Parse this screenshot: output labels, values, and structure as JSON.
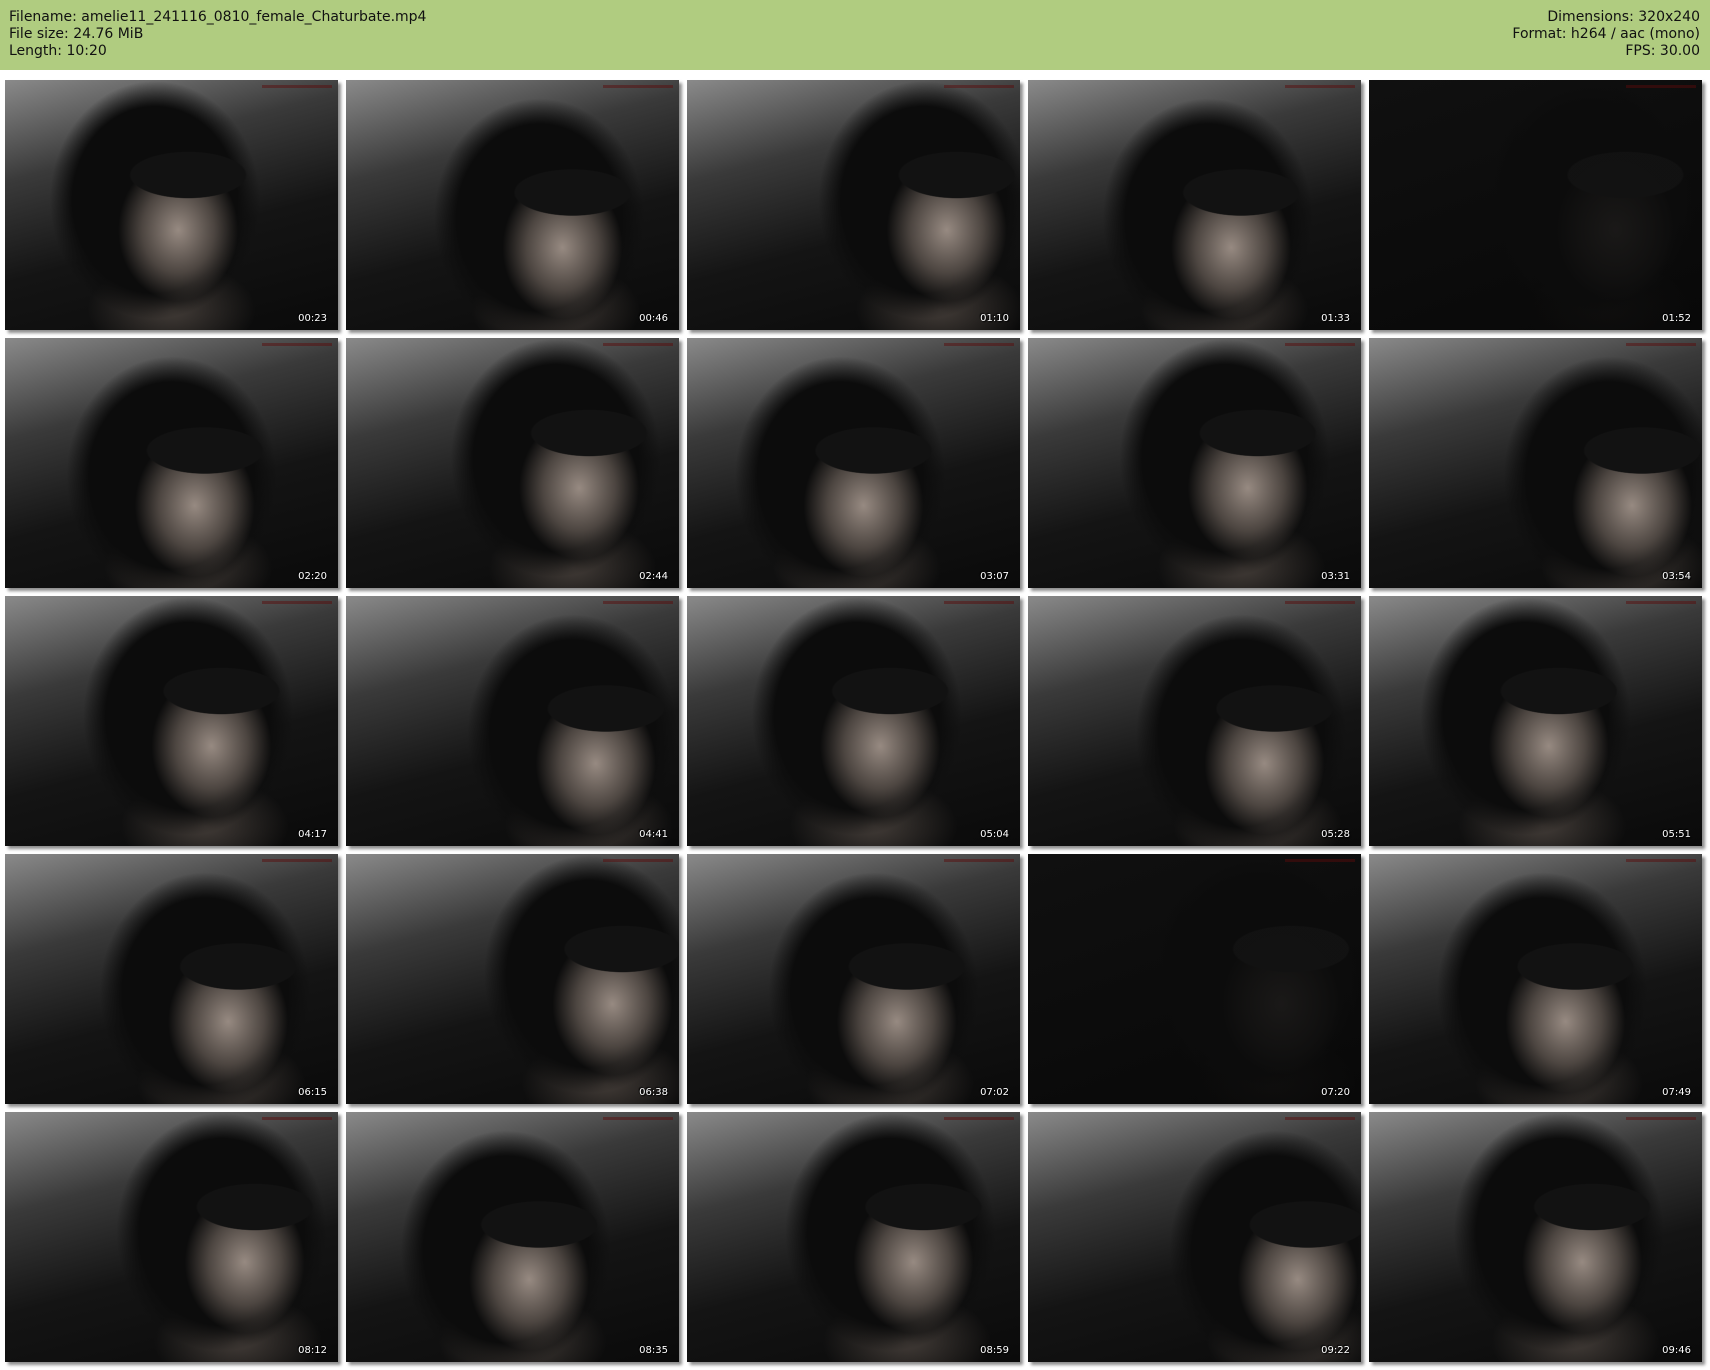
{
  "header": {
    "filename": "Filename: amelie11_241116_0810_female_Chaturbate.mp4",
    "file_size": "File size: 24.76 MiB",
    "length": "Length: 10:20",
    "dimensions": "Dimensions: 320x240",
    "format": "Format: h264 / aac (mono)",
    "fps": "FPS: 30.00"
  },
  "thumbnails": [
    {
      "time": "00:23"
    },
    {
      "time": "00:46"
    },
    {
      "time": "01:10"
    },
    {
      "time": "01:33"
    },
    {
      "time": "01:52"
    },
    {
      "time": "02:20"
    },
    {
      "time": "02:44"
    },
    {
      "time": "03:07"
    },
    {
      "time": "03:31"
    },
    {
      "time": "03:54"
    },
    {
      "time": "04:17"
    },
    {
      "time": "04:41"
    },
    {
      "time": "05:04"
    },
    {
      "time": "05:28"
    },
    {
      "time": "05:51"
    },
    {
      "time": "06:15"
    },
    {
      "time": "06:38"
    },
    {
      "time": "07:02"
    },
    {
      "time": "07:20"
    },
    {
      "time": "07:49"
    },
    {
      "time": "08:12"
    },
    {
      "time": "08:35"
    },
    {
      "time": "08:59"
    },
    {
      "time": "09:22"
    },
    {
      "time": "09:46"
    }
  ],
  "dark_frames": [
    "01:52",
    "07:20"
  ]
}
